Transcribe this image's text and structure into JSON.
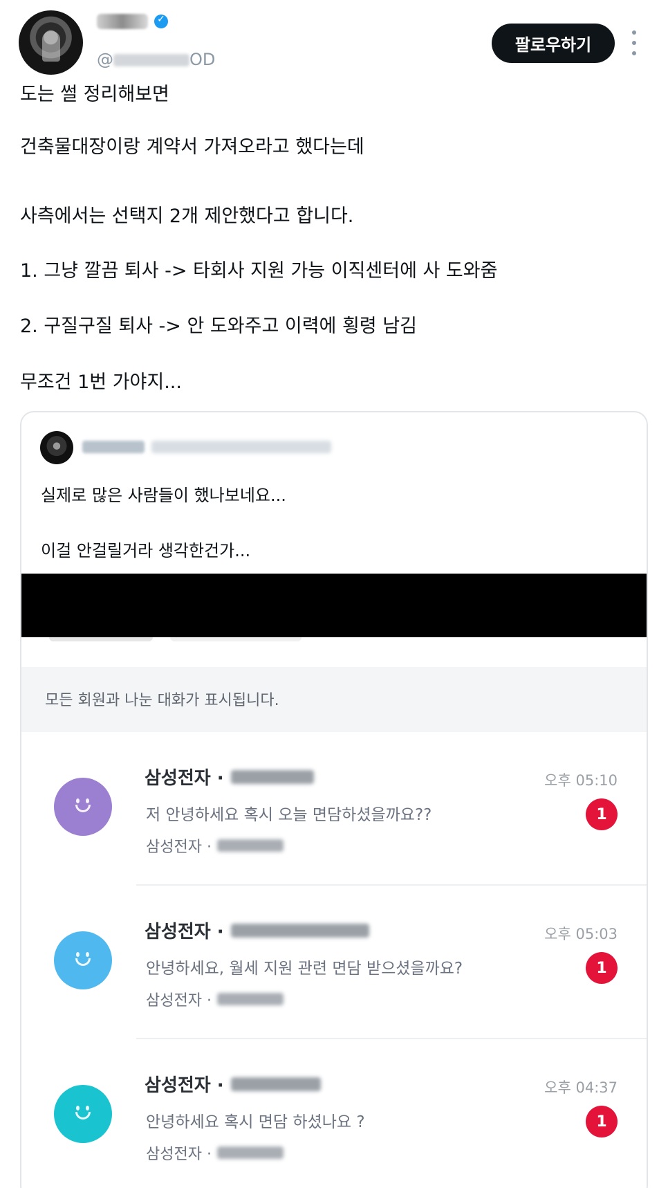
{
  "header": {
    "avatar": "profile-photo",
    "verified_badge": "verified-icon",
    "handle_visible": "@",
    "handle_suffix": "OD",
    "follow_label": "팔로우하기"
  },
  "tweet": {
    "lines": [
      "도는 썰 정리해보면",
      "건축물대장이랑 계약서 가져오라고 했다는데",
      "사측에서는 선택지 2개 제안했다고 합니다.",
      "1. 그냥 깔끔 퇴사 -> 타회사 지원 가능 이직센터에 사 도와줌",
      "2. 구질구질 퇴사 -> 안 도와주고 이력에 횡령 남김",
      "무조건 1번 가야지..."
    ]
  },
  "quote": {
    "text_lines": [
      "실제로 많은 사람들이 했나보네요...",
      "이걸 안걸릴거라 생각한건가..."
    ],
    "screenshot": {
      "notice": "모든 회원과 나눈 대화가 표시됩니다.",
      "conversations": [
        {
          "company": "삼성전자 ·",
          "message": "저 안녕하세요 혹시 오늘 면담하셨을까요??",
          "sub": "삼성전자 ·",
          "time": "오후 05:10",
          "unread": "1",
          "avatar_color": "#9b7fd0"
        },
        {
          "company": "삼성전자 ·",
          "message": "안녕하세요, 월세 지원 관련 면담 받으셨을까요?",
          "sub": "삼성전자 ·",
          "time": "오후 05:03",
          "unread": "1",
          "avatar_color": "#4fb8ef"
        },
        {
          "company": "삼성전자 ·",
          "message": "안녕하세요 혹시 면담 하셨나요 ?",
          "sub": "삼성전자 ·",
          "time": "오후 04:37",
          "unread": "1",
          "avatar_color": "#19c3cf"
        }
      ]
    }
  },
  "colors": {
    "follow_button": "#0f1419",
    "badge": "#e4133a",
    "verified": "#1d9bf0"
  }
}
